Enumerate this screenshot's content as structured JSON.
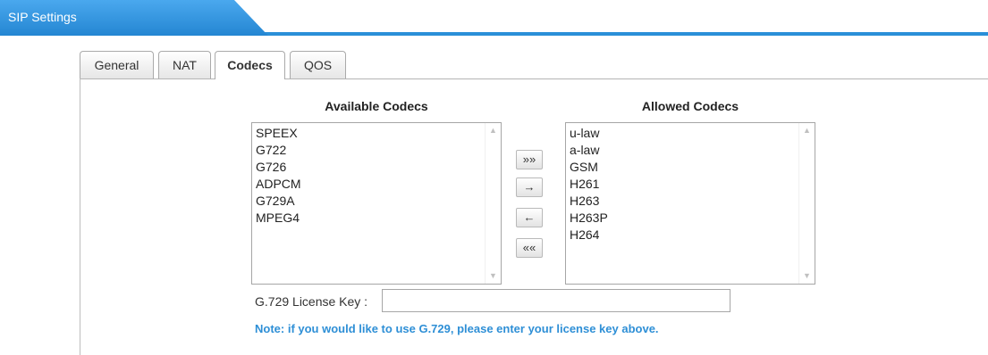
{
  "header": {
    "title": "SIP Settings"
  },
  "tabs": [
    {
      "label": "General",
      "active": false
    },
    {
      "label": "NAT",
      "active": false
    },
    {
      "label": "Codecs",
      "active": true
    },
    {
      "label": "QOS",
      "active": false
    }
  ],
  "codecs": {
    "available_title": "Available Codecs",
    "allowed_title": "Allowed Codecs",
    "available": [
      "SPEEX",
      "G722",
      "G726",
      "ADPCM",
      "G729A",
      "MPEG4"
    ],
    "allowed": [
      "u-law",
      "a-law",
      "GSM",
      "H261",
      "H263",
      "H263P",
      "H264"
    ],
    "buttons": {
      "add_all": "»»",
      "add": "→",
      "remove": "←",
      "remove_all": "««"
    }
  },
  "license": {
    "label": "G.729 License Key :",
    "value": "",
    "note": "Note: if you would like to use G.729, please enter your license key above."
  },
  "colors": {
    "accent": "#2a8fd8",
    "note": "#2e8fd6"
  }
}
